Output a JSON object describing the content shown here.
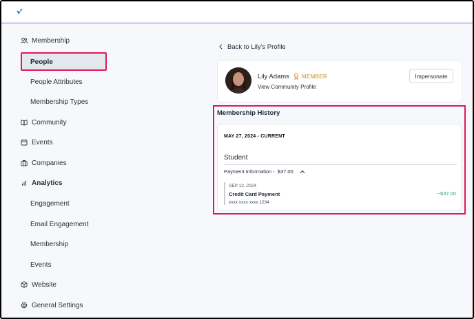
{
  "sidebar": {
    "sections": [
      {
        "label": "Membership",
        "icon": "people-icon"
      },
      {
        "label": "Community",
        "icon": "book-icon"
      },
      {
        "label": "Events",
        "icon": "calendar-icon"
      },
      {
        "label": "Companies",
        "icon": "briefcase-icon"
      },
      {
        "label": "Analytics",
        "icon": "bar-chart-icon"
      },
      {
        "label": "Website",
        "icon": "cube-icon"
      },
      {
        "label": "General Settings",
        "icon": "gear-icon"
      }
    ],
    "membership_items": [
      "People",
      "People Attributes",
      "Membership Types"
    ],
    "analytics_items": [
      "Engagement",
      "Email Engagement",
      "Membership",
      "Events"
    ]
  },
  "back_link": "Back to Lily's Profile",
  "profile": {
    "name": "Lily Adams",
    "badge": "MEMBER",
    "link": "View Community Profile",
    "impersonate": "Impersonate"
  },
  "history": {
    "title": "Membership History",
    "date": "MAY 27, 2024 - CURRENT",
    "type": "Student",
    "payment_label": "Payment Information -",
    "payment_amount": "$37.00",
    "entry": {
      "date": "SEP 12, 2024",
      "title": "Credit Card Payment",
      "card": "xxxx xxxx xxxx 1234",
      "amount": "−$37.00"
    }
  },
  "colors": {
    "accent": "#e0185a",
    "badge": "#d08b26",
    "positive": "#2aa876",
    "brand": "#3a6fd8"
  }
}
